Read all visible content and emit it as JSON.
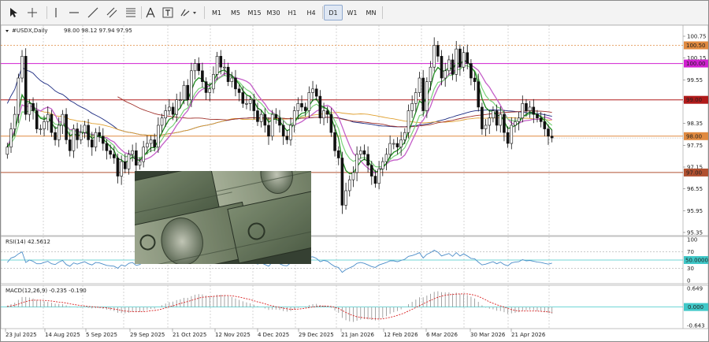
{
  "toolbar": {
    "timeframes": [
      "M1",
      "M5",
      "M15",
      "M30",
      "H1",
      "H4",
      "D1",
      "W1",
      "MN"
    ],
    "active_timeframe": "D1"
  },
  "colors": {
    "bull": "#1a1a1a",
    "ema_fast": "#1e8c1e",
    "ema_slow": "#79d279",
    "ma_purple": "#c45ec8",
    "ma_navy": "#1b2a80",
    "ma_orange": "#e0a030",
    "ma_brown": "#a0302a",
    "rsi_line": "#4a8cc8",
    "macd_hist": "#9a9a9a",
    "macd_signal": "#d82020",
    "hline_magenta": "#d020d0",
    "hline_red": "#b01a1a",
    "hline_orange": "#e08a40",
    "hline_brown": "#b05030",
    "zero_line": "#40c8c8"
  },
  "chart_data": [
    {
      "type": "candlestick",
      "title": "#USDX,Daily",
      "ohlc_header": "98.00 98.12 97.94 97.95",
      "ylim": [
        95.35,
        100.88
      ],
      "y_ticks": [
        "100.75",
        "100.15",
        "99.55",
        "98.95",
        "98.35",
        "97.75",
        "97.15",
        "96.55",
        "95.95",
        "95.35"
      ],
      "x_ticks": [
        "23 Jul 2025",
        "14 Aug 2025",
        "5 Sep 2025",
        "29 Sep 2025",
        "21 Oct 2025",
        "12 Nov 2025",
        "4 Dec 2025",
        "29 Dec 2025",
        "21 Jan 2026",
        "12 Feb 2026",
        "6 Mar 2026",
        "30 Mar 2026",
        "21 Apr 2026"
      ],
      "price_lines": [
        {
          "value": 100.5,
          "label": "100.50"
        },
        {
          "value": 100.0,
          "label": "100.00"
        },
        {
          "value": 99.0,
          "label": "99.00"
        },
        {
          "value": 98.0,
          "label": "98.00"
        },
        {
          "value": 97.0,
          "label": "97.00"
        }
      ],
      "series_close": [
        97.7,
        98.2,
        98.6,
        99.6,
        100.2,
        98.6,
        98.9,
        98.7,
        98.2,
        98.2,
        98.4,
        98.6,
        98.1,
        97.9,
        98.3,
        98.6,
        97.9,
        97.6,
        98.2,
        97.9,
        98.1,
        98.3,
        97.9,
        97.7,
        98.1,
        98.0,
        97.8,
        97.6,
        97.5,
        97.4,
        96.9,
        97.3,
        97.1,
        97.5,
        97.6,
        97.2,
        97.3,
        97.7,
        97.8,
        97.9,
        97.7,
        98.3,
        98.5,
        98.7,
        98.8,
        98.6,
        99.0,
        99.0,
        99.4,
        99.0,
        99.8,
        100.0,
        99.8,
        99.5,
        99.2,
        99.3,
        99.7,
        100.2,
        99.9,
        99.9,
        99.5,
        99.6,
        99.3,
        99.2,
        98.9,
        98.9,
        99.0,
        98.7,
        98.4,
        98.6,
        98.3,
        98.0,
        98.6,
        98.5,
        98.3,
        98.0,
        97.9,
        98.3,
        98.7,
        98.9,
        98.8,
        98.7,
        99.2,
        99.3,
        99.1,
        98.5,
        98.7,
        98.6,
        98.1,
        97.6,
        97.4,
        96.1,
        96.5,
        96.8,
        97.0,
        97.5,
        97.6,
        97.5,
        97.2,
        96.9,
        96.7,
        97.1,
        97.3,
        97.5,
        97.8,
        97.8,
        97.7,
        97.9,
        98.1,
        98.7,
        98.9,
        99.2,
        99.6,
        98.7,
        99.5,
        99.9,
        100.5,
        100.2,
        99.6,
        99.8,
        100.1,
        99.7,
        100.4,
        99.9,
        100.3,
        100.0,
        99.6,
        99.5,
        98.8,
        98.2,
        98.3,
        98.5,
        98.7,
        98.3,
        98.6,
        98.1,
        97.8,
        98.3,
        98.4,
        98.5,
        98.9,
        98.7,
        98.8,
        98.6,
        98.5,
        98.4,
        98.2,
        98.0,
        97.95
      ]
    },
    {
      "type": "line",
      "title": "RSI(14) 42.5612",
      "ylim": [
        0,
        100
      ],
      "y_ticks": [
        "100",
        "70",
        "50.0000",
        "30",
        "0"
      ],
      "current_label": "50.0000",
      "levels": [
        30,
        50,
        70
      ],
      "values": [
        44,
        55,
        58,
        65,
        70,
        44,
        50,
        47,
        41,
        41,
        44,
        47,
        41,
        39,
        45,
        49,
        39,
        35,
        43,
        40,
        43,
        46,
        41,
        38,
        44,
        43,
        40,
        37,
        36,
        35,
        30,
        38,
        35,
        42,
        44,
        37,
        39,
        46,
        47,
        49,
        45,
        55,
        58,
        60,
        62,
        58,
        63,
        63,
        67,
        59,
        70,
        72,
        67,
        62,
        57,
        58,
        63,
        69,
        64,
        64,
        57,
        59,
        53,
        52,
        47,
        47,
        49,
        44,
        40,
        43,
        39,
        35,
        45,
        44,
        41,
        37,
        36,
        43,
        50,
        53,
        51,
        50,
        57,
        58,
        54,
        46,
        49,
        47,
        40,
        34,
        32,
        20,
        27,
        31,
        35,
        42,
        44,
        42,
        38,
        34,
        32,
        38,
        41,
        44,
        48,
        48,
        46,
        49,
        52,
        59,
        61,
        64,
        68,
        55,
        64,
        68,
        74,
        69,
        60,
        63,
        66,
        59,
        68,
        60,
        65,
        60,
        54,
        53,
        45,
        38,
        40,
        43,
        46,
        41,
        45,
        39,
        36,
        43,
        45,
        46,
        51,
        48,
        49,
        47,
        45,
        44,
        42,
        40,
        42.56
      ]
    },
    {
      "type": "bar",
      "title": "MACD(12,26,9) -0.235 -0.190",
      "ylim": [
        -0.643,
        0.649
      ],
      "y_ticks": [
        "0.649",
        "0.000",
        "-0.643"
      ],
      "current_label": "0.000",
      "histogram": [
        0.05,
        0.1,
        0.15,
        0.25,
        0.35,
        0.35,
        0.33,
        0.3,
        0.25,
        0.22,
        0.2,
        0.18,
        0.15,
        0.12,
        0.11,
        0.1,
        0.06,
        0.02,
        0.0,
        -0.02,
        -0.02,
        -0.01,
        -0.03,
        -0.05,
        -0.04,
        -0.04,
        -0.06,
        -0.09,
        -0.11,
        -0.14,
        -0.2,
        -0.21,
        -0.22,
        -0.2,
        -0.17,
        -0.18,
        -0.17,
        -0.14,
        -0.1,
        -0.07,
        -0.06,
        0.0,
        0.06,
        0.12,
        0.17,
        0.19,
        0.24,
        0.27,
        0.32,
        0.32,
        0.38,
        0.43,
        0.45,
        0.44,
        0.4,
        0.38,
        0.39,
        0.43,
        0.43,
        0.42,
        0.38,
        0.35,
        0.3,
        0.25,
        0.2,
        0.16,
        0.13,
        0.08,
        0.03,
        0.0,
        -0.05,
        -0.1,
        -0.09,
        -0.09,
        -0.1,
        -0.14,
        -0.16,
        -0.14,
        -0.08,
        -0.03,
        0.0,
        0.02,
        0.07,
        0.1,
        0.11,
        0.07,
        0.05,
        0.03,
        -0.03,
        -0.12,
        -0.2,
        -0.38,
        -0.46,
        -0.5,
        -0.52,
        -0.48,
        -0.44,
        -0.42,
        -0.43,
        -0.45,
        -0.47,
        -0.43,
        -0.38,
        -0.32,
        -0.24,
        -0.18,
        -0.14,
        -0.08,
        -0.01,
        0.1,
        0.18,
        0.26,
        0.34,
        0.34,
        0.4,
        0.46,
        0.53,
        0.55,
        0.52,
        0.51,
        0.51,
        0.47,
        0.5,
        0.46,
        0.46,
        0.42,
        0.36,
        0.3,
        0.18,
        0.06,
        -0.02,
        -0.06,
        -0.08,
        -0.13,
        -0.14,
        -0.18,
        -0.24,
        -0.22,
        -0.2,
        -0.18,
        -0.12,
        -0.11,
        -0.1,
        -0.11,
        -0.13,
        -0.15,
        -0.18,
        -0.21,
        -0.235
      ],
      "signal": [
        0.02,
        0.04,
        0.06,
        0.1,
        0.15,
        0.19,
        0.22,
        0.24,
        0.24,
        0.24,
        0.23,
        0.22,
        0.21,
        0.19,
        0.17,
        0.16,
        0.14,
        0.11,
        0.09,
        0.07,
        0.05,
        0.04,
        0.02,
        0.01,
        0.0,
        -0.01,
        -0.02,
        -0.03,
        -0.05,
        -0.07,
        -0.09,
        -0.12,
        -0.14,
        -0.15,
        -0.16,
        -0.16,
        -0.16,
        -0.16,
        -0.15,
        -0.13,
        -0.12,
        -0.1,
        -0.07,
        -0.03,
        0.01,
        0.04,
        0.08,
        0.12,
        0.16,
        0.19,
        0.23,
        0.27,
        0.31,
        0.34,
        0.35,
        0.36,
        0.37,
        0.38,
        0.39,
        0.4,
        0.4,
        0.39,
        0.37,
        0.35,
        0.32,
        0.29,
        0.26,
        0.22,
        0.18,
        0.15,
        0.11,
        0.07,
        0.04,
        0.01,
        -0.01,
        -0.04,
        -0.06,
        -0.08,
        -0.08,
        -0.07,
        -0.06,
        -0.04,
        -0.02,
        0.0,
        0.02,
        0.03,
        0.03,
        0.03,
        0.02,
        -0.01,
        -0.05,
        -0.12,
        -0.19,
        -0.25,
        -0.3,
        -0.34,
        -0.36,
        -0.38,
        -0.39,
        -0.4,
        -0.41,
        -0.42,
        -0.41,
        -0.39,
        -0.36,
        -0.33,
        -0.29,
        -0.25,
        -0.2,
        -0.14,
        -0.08,
        -0.02,
        0.05,
        0.11,
        0.17,
        0.23,
        0.29,
        0.34,
        0.38,
        0.41,
        0.43,
        0.44,
        0.45,
        0.46,
        0.46,
        0.46,
        0.44,
        0.41,
        0.37,
        0.31,
        0.25,
        0.18,
        0.13,
        0.08,
        0.04,
        0.0,
        -0.05,
        -0.09,
        -0.12,
        -0.14,
        -0.14,
        -0.14,
        -0.14,
        -0.14,
        -0.14,
        -0.15,
        -0.16,
        -0.17,
        -0.19
      ]
    }
  ]
}
